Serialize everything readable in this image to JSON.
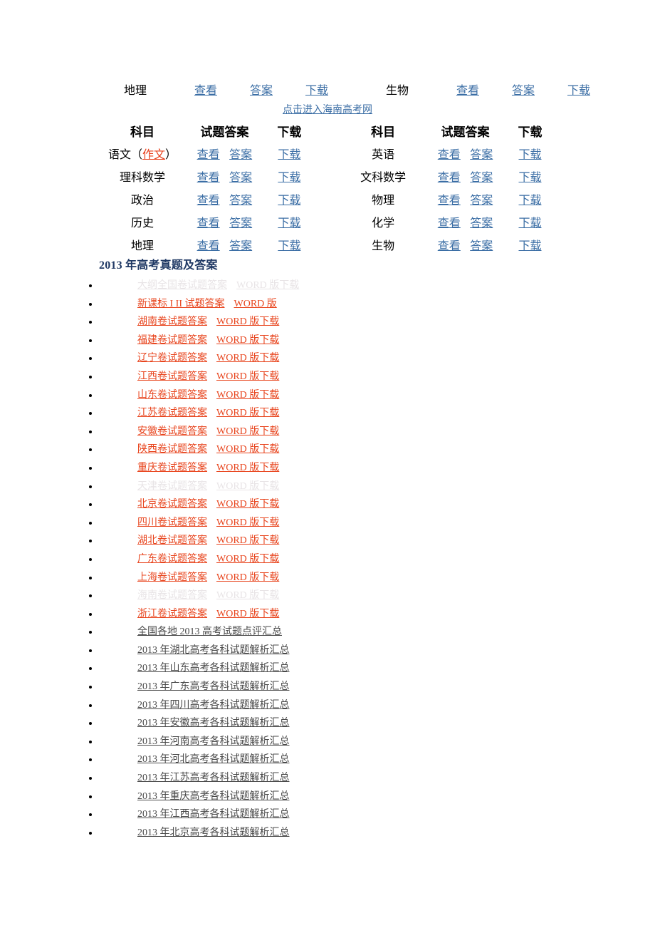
{
  "top_table": {
    "rows": [
      {
        "left_subject": "地理",
        "left_links": [
          "查看",
          "答案",
          "下载"
        ],
        "right_subject": "生物",
        "right_links": [
          "查看",
          "答案",
          "下载"
        ]
      }
    ]
  },
  "note": {
    "link_text": "点击进入海南高考网"
  },
  "main_table": {
    "header": {
      "subject": "科目",
      "answers": "试题答案",
      "download": "下载",
      "subject2": "科目",
      "answers2": "试题答案",
      "download2": "下载"
    },
    "rows": [
      {
        "left_subject_pre": "语文（",
        "left_subject_red": "作文",
        "left_subject_post": "）",
        "left_links": [
          "查看",
          "答案",
          "下载"
        ],
        "right_subject": "英语",
        "right_links": [
          "查看",
          "答案",
          "下载"
        ]
      },
      {
        "left_subject": "理科数学",
        "left_links": [
          "查看",
          "答案",
          "下载"
        ],
        "right_subject": "文科数学",
        "right_links": [
          "查看",
          "答案",
          "下载"
        ]
      },
      {
        "left_subject": "政治",
        "left_links": [
          "查看",
          "答案",
          "下载"
        ],
        "right_subject": "物理",
        "right_links": [
          "查看",
          "答案",
          "下载"
        ]
      },
      {
        "left_subject": "历史",
        "left_links": [
          "查看",
          "答案",
          "下载"
        ],
        "right_subject": "化学",
        "right_links": [
          "查看",
          "答案",
          "下载"
        ]
      },
      {
        "left_subject": "地理",
        "left_links": [
          "查看",
          "答案",
          "下载"
        ],
        "right_subject": "生物",
        "right_links": [
          "查看",
          "答案",
          "下载"
        ]
      }
    ]
  },
  "section": {
    "title": "2013 年高考真题及答案"
  },
  "list": {
    "items": [
      {
        "first": "大纲全国卷试题答案",
        "second": "WORD 版下载",
        "style": "faded"
      },
      {
        "first": "新课标 I II 试题答案",
        "second": "WORD 版",
        "style": "orange"
      },
      {
        "first": "湖南卷试题答案",
        "second": "WORD 版下载",
        "style": "orange"
      },
      {
        "first": "福建卷试题答案",
        "second": "WORD 版下载",
        "style": "orange"
      },
      {
        "first": "辽宁卷试题答案",
        "second": "WORD 版下载",
        "style": "orange"
      },
      {
        "first": "江西卷试题答案",
        "second": "WORD 版下载",
        "style": "orange"
      },
      {
        "first": "山东卷试题答案",
        "second": "WORD 版下载",
        "style": "orange"
      },
      {
        "first": "江苏卷试题答案",
        "second": "WORD 版下载",
        "style": "orange"
      },
      {
        "first": "安徽卷试题答案",
        "second": "WORD 版下载",
        "style": "orange"
      },
      {
        "first": "陕西卷试题答案",
        "second": "WORD 版下载",
        "style": "orange"
      },
      {
        "first": "重庆卷试题答案",
        "second": "WORD 版下载",
        "style": "orange"
      },
      {
        "first": "天津卷试题答案",
        "second": "WORD 版下载",
        "style": "faded"
      },
      {
        "first": "北京卷试题答案",
        "second": "WORD 版下载",
        "style": "orange"
      },
      {
        "first": "四川卷试题答案",
        "second": "WORD 版下载",
        "style": "orange"
      },
      {
        "first": "湖北卷试题答案",
        "second": "WORD 版下载",
        "style": "orange"
      },
      {
        "first": "广东卷试题答案",
        "second": "WORD 版下载",
        "style": "orange"
      },
      {
        "first": "上海卷试题答案",
        "second": "WORD 版下载",
        "style": "orange"
      },
      {
        "first": "海南卷试题答案",
        "second": "WORD 版下载",
        "style": "faded"
      },
      {
        "first": "浙江卷试题答案",
        "second": "WORD 版下载",
        "style": "orange"
      },
      {
        "first": "全国各地 2013 高考试题点评汇总",
        "second": "",
        "style": "dark"
      },
      {
        "first": "2013 年湖北高考各科试题解析汇总",
        "second": "",
        "style": "dark"
      },
      {
        "first": "2013 年山东高考各科试题解析汇总",
        "second": "",
        "style": "dark"
      },
      {
        "first": "2013 年广东高考各科试题解析汇总",
        "second": "",
        "style": "dark"
      },
      {
        "first": "2013 年四川高考各科试题解析汇总",
        "second": "",
        "style": "dark"
      },
      {
        "first": "2013 年安徽高考各科试题解析汇总",
        "second": "",
        "style": "dark"
      },
      {
        "first": "2013 年河南高考各科试题解析汇总",
        "second": "",
        "style": "dark"
      },
      {
        "first": "2013 年河北高考各科试题解析汇总",
        "second": "",
        "style": "dark"
      },
      {
        "first": "2013 年江苏高考各科试题解析汇总",
        "second": "",
        "style": "dark"
      },
      {
        "first": "2013 年重庆高考各科试题解析汇总",
        "second": "",
        "style": "dark"
      },
      {
        "first": "2013 年江西高考各科试题解析汇总",
        "second": "",
        "style": "dark"
      },
      {
        "first": "2013 年北京高考各科试题解析汇总",
        "second": "",
        "style": "dark"
      }
    ]
  },
  "colors": {
    "link_blue": "#3B6EA5",
    "heading_navy": "#1F3864",
    "orange": "#E8451E",
    "faded": "#E6E4E4",
    "dark": "#4A4A4A",
    "red": "#E8401C"
  }
}
